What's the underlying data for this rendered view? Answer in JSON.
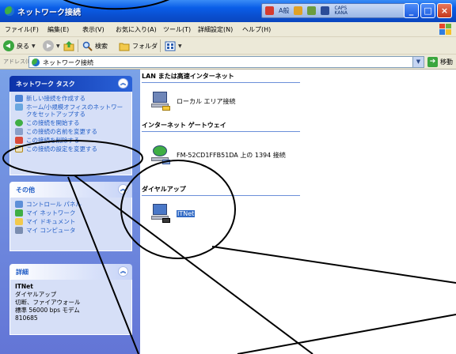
{
  "window": {
    "title": "ネットワーク接続"
  },
  "ime_bar": {
    "mode": "A般",
    "caps": "CAPS",
    "kana": "KANA"
  },
  "menu": [
    "ファイル(F)",
    "編集(E)",
    "表示(V)",
    "お気に入り(A)",
    "ツール(T)",
    "詳細設定(N)",
    "ヘルプ(H)"
  ],
  "toolbar": {
    "back": "戻る",
    "search": "検索",
    "folders": "フォルダ"
  },
  "address": {
    "label": "アドレス(D)",
    "value": "ネットワーク接続",
    "go": "移動"
  },
  "network_tasks": {
    "title": "ネットワーク タスク",
    "items": [
      "新しい接続を作成する",
      "ホーム/小規模オフィスのネットワークをセットアップする",
      "この接続を開始する",
      "この接続の名前を変更する",
      "この接続を削除する",
      "この接続の設定を変更する"
    ]
  },
  "other_places": {
    "title": "その他",
    "items": [
      "コントロール パネル",
      "マイ ネットワーク",
      "マイ ドキュメント",
      "マイ コンピュータ"
    ]
  },
  "details": {
    "title": "詳細",
    "name": "ITNet",
    "type": "ダイヤルアップ",
    "status": "切断、ファイアウォール",
    "device": "標準 56000 bps モデム",
    "number": "810685"
  },
  "groups": {
    "lan": {
      "title": "LAN または高速インターネット",
      "item": "ローカル エリア接続"
    },
    "gateway": {
      "title": "インターネット ゲートウェイ",
      "item": "FM-52CD1FFB51DA 上の 1394 接続"
    },
    "dialup": {
      "title": "ダイヤルアップ",
      "item": "ITNet"
    }
  },
  "colors": {
    "titlebar": "#0a5ee8",
    "taskpane": "#7ba2e7",
    "link": "#215dc6",
    "selection": "#316ac5"
  }
}
